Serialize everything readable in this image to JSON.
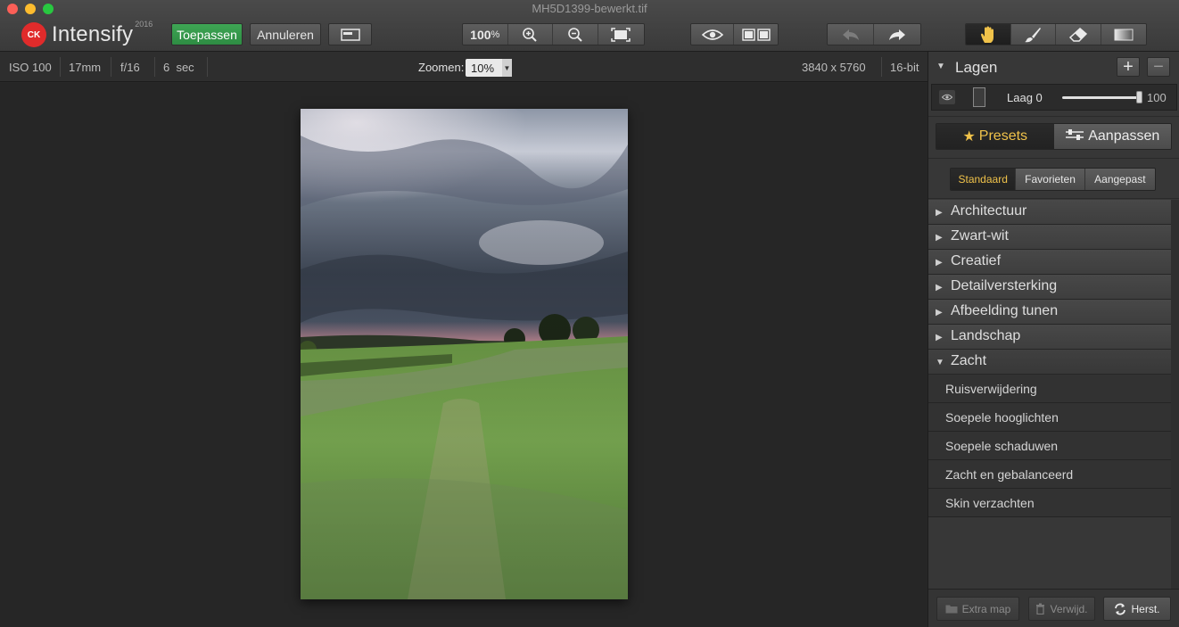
{
  "window": {
    "title": "MH5D1399-bewerkt.tif"
  },
  "app": {
    "badge": "CK",
    "name": "Intensify",
    "year": "2016"
  },
  "toolbar": {
    "apply_label": "Toepassen",
    "cancel_label": "Annuleren",
    "zoom_percent": "100",
    "zoom_unit": "%"
  },
  "info": {
    "iso": "ISO 100",
    "focal": "17mm",
    "aperture": "f/16",
    "shutter": "6  sec",
    "zoom_label": "Zoomen:",
    "zoom_value": "10%",
    "dimensions": "3840 x 5760",
    "bitdepth": "16-bit"
  },
  "layers": {
    "title": "Lagen",
    "add_symbol": "+",
    "remove_symbol": "−",
    "layer_name": "Laag 0",
    "opacity": "100",
    "opacity_level": 1.0
  },
  "tabs": {
    "presets_label": "Presets",
    "adjust_label": "Aanpassen"
  },
  "subtabs": [
    "Standaard",
    "Favorieten",
    "Aangepast"
  ],
  "categories": [
    "Architectuur",
    "Zwart-wit",
    "Creatief",
    "Detailversterking",
    "Afbeelding tunen",
    "Landschap",
    "Zacht"
  ],
  "presets": [
    "Ruisverwijdering",
    "Soepele hooglichten",
    "Soepele schaduwen",
    "Zacht en gebalanceerd",
    "Skin verzachten"
  ],
  "bottom": {
    "extra_label": "Extra map",
    "delete_label": "Verwijd.",
    "restore_label": "Herst."
  },
  "colors": {
    "accent": "#f0c24a",
    "apply_green": "#36a04d",
    "logo_red": "#e02b2b"
  },
  "icons": [
    "hand-icon",
    "brush-icon",
    "eraser-icon",
    "gradient-icon",
    "undo-icon",
    "redo-icon",
    "eye-icon",
    "compare-icon",
    "zoom-in-icon",
    "zoom-out-icon",
    "fit-icon"
  ]
}
